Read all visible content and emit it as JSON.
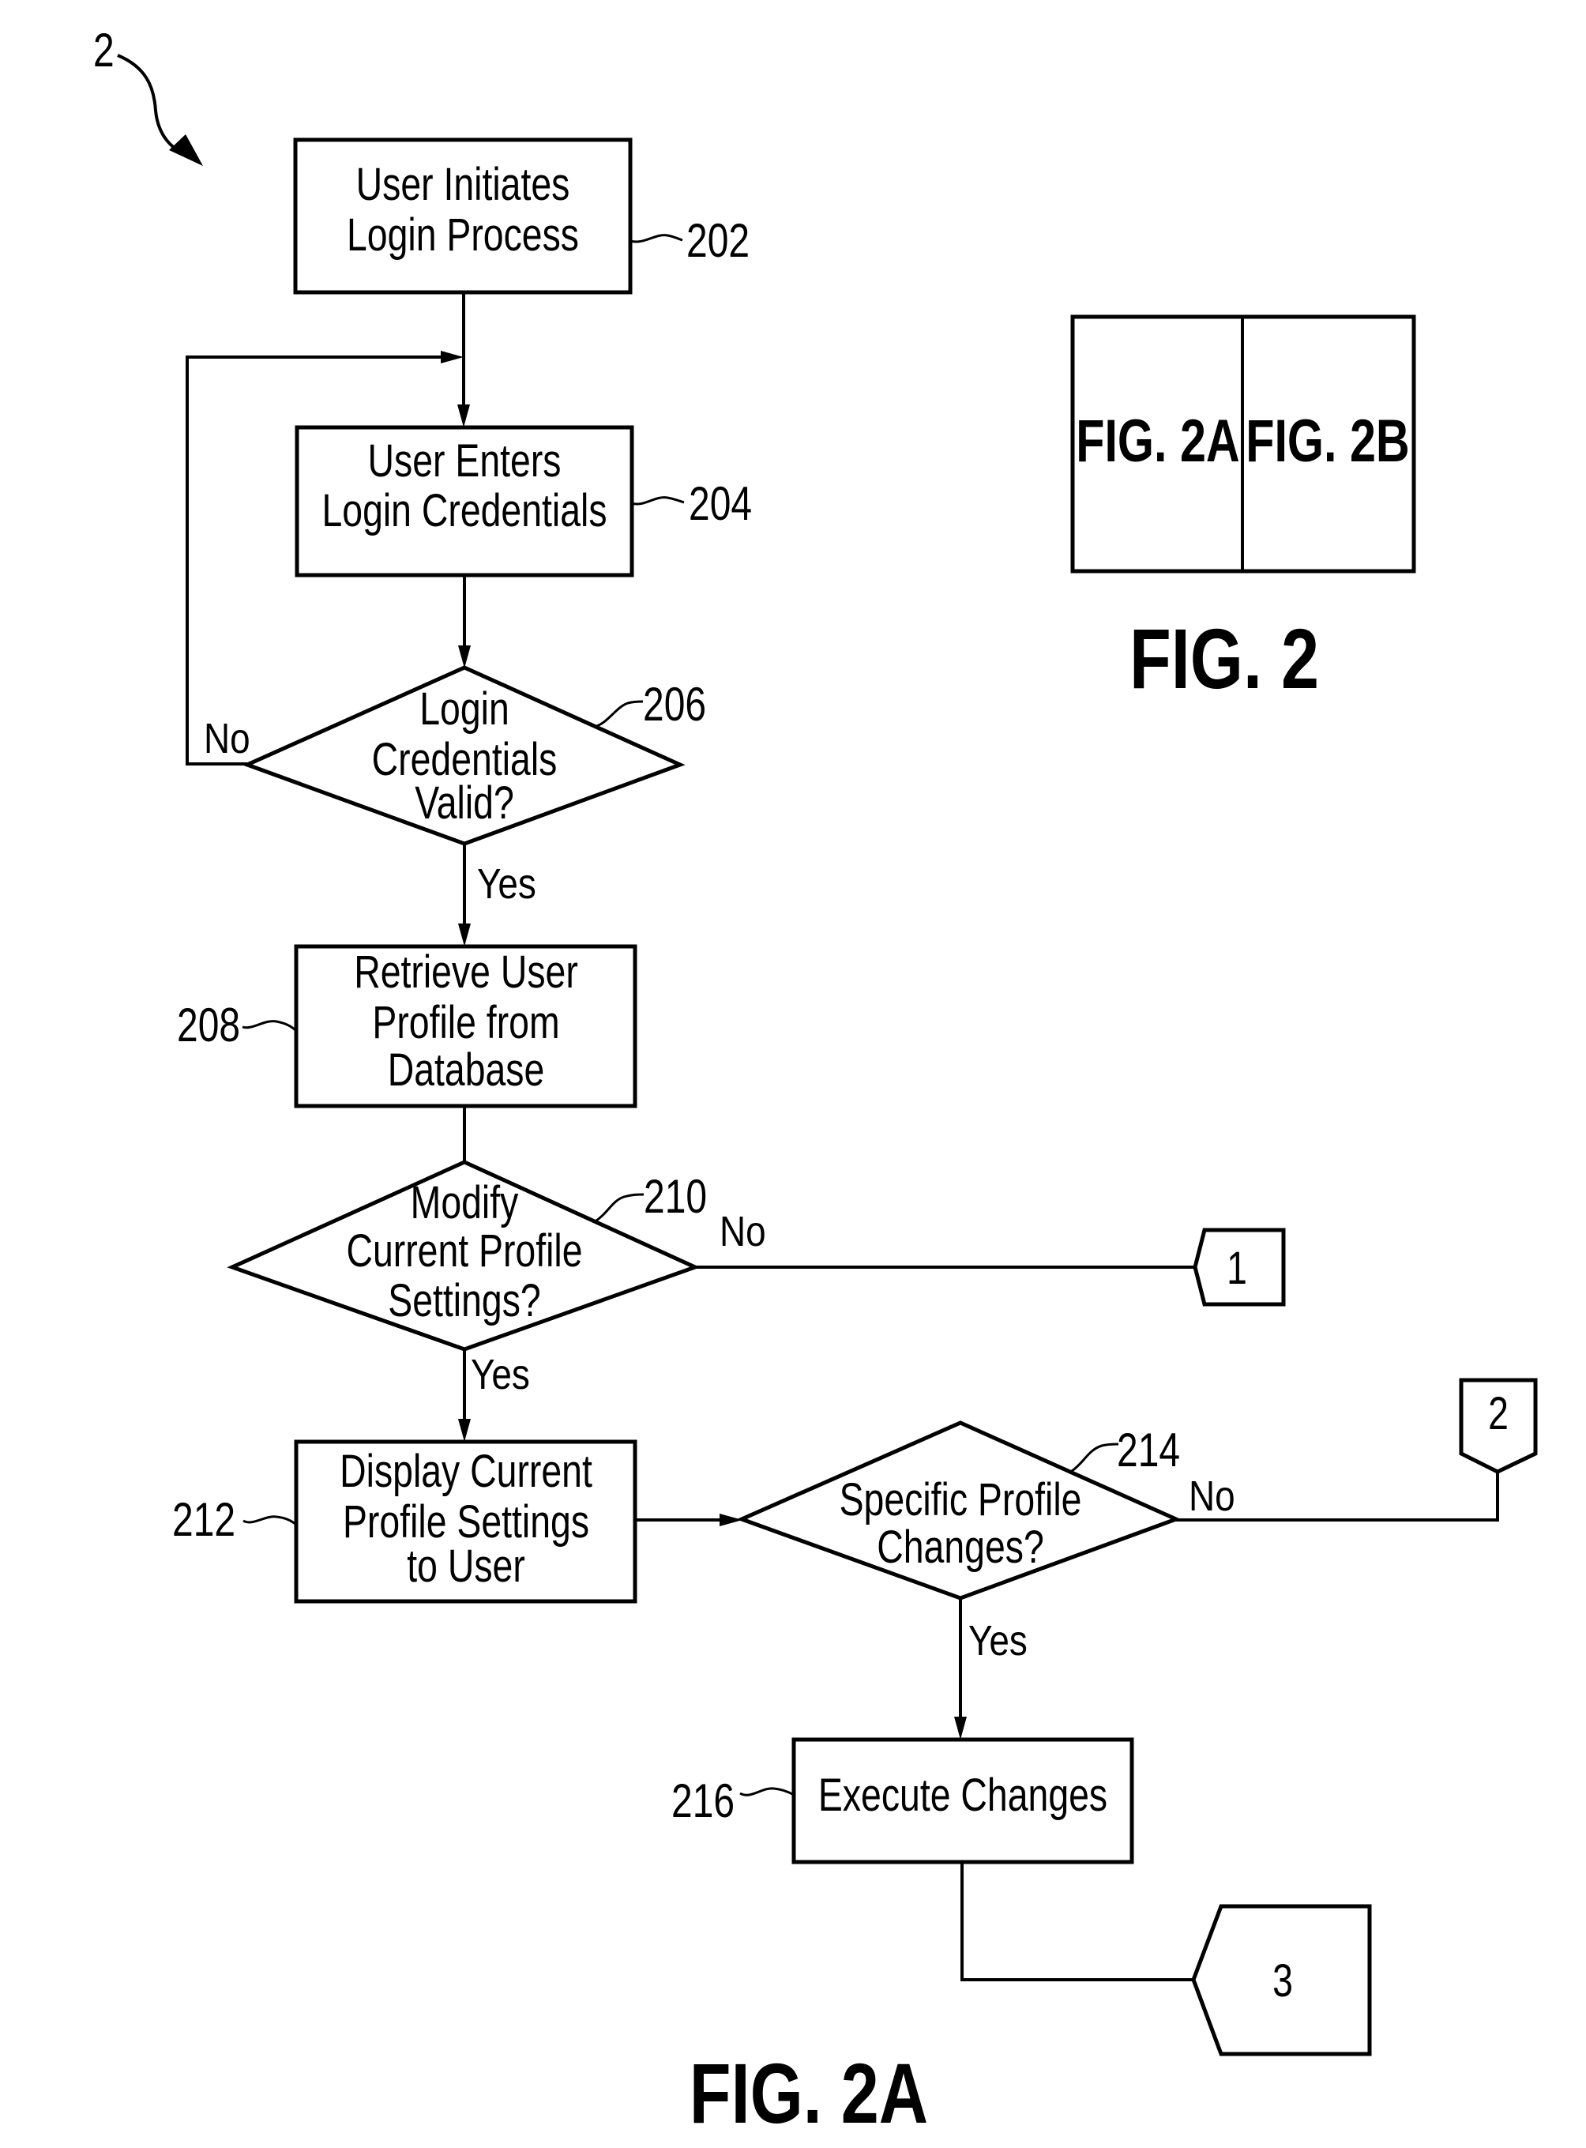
{
  "figure_ref": "2",
  "steps": {
    "s202": {
      "ref": "202",
      "lines": [
        "User Initiates",
        "Login Process"
      ]
    },
    "s204": {
      "ref": "204",
      "lines": [
        "User Enters",
        "Login Credentials"
      ]
    },
    "s206": {
      "ref": "206",
      "lines": [
        "Login",
        "Credentials",
        "Valid?"
      ],
      "yes": "Yes",
      "no": "No"
    },
    "s208": {
      "ref": "208",
      "lines": [
        "Retrieve User",
        "Profile from",
        "Database"
      ]
    },
    "s210": {
      "ref": "210",
      "lines": [
        "Modify",
        "Current Profile",
        "Settings?"
      ],
      "yes": "Yes",
      "no": "No"
    },
    "s212": {
      "ref": "212",
      "lines": [
        "Display Current",
        "Profile Settings",
        "to User"
      ]
    },
    "s214": {
      "ref": "214",
      "lines": [
        "Specific Profile",
        "Changes?"
      ],
      "yes": "Yes",
      "no": "No"
    },
    "s216": {
      "ref": "216",
      "lines": [
        "Execute Changes"
      ]
    }
  },
  "connectors": {
    "c1": "1",
    "c2": "2",
    "c3": "3"
  },
  "figure_map": {
    "left": "FIG. 2A",
    "right": "FIG. 2B",
    "caption": "FIG. 2"
  },
  "caption": "FIG. 2A"
}
